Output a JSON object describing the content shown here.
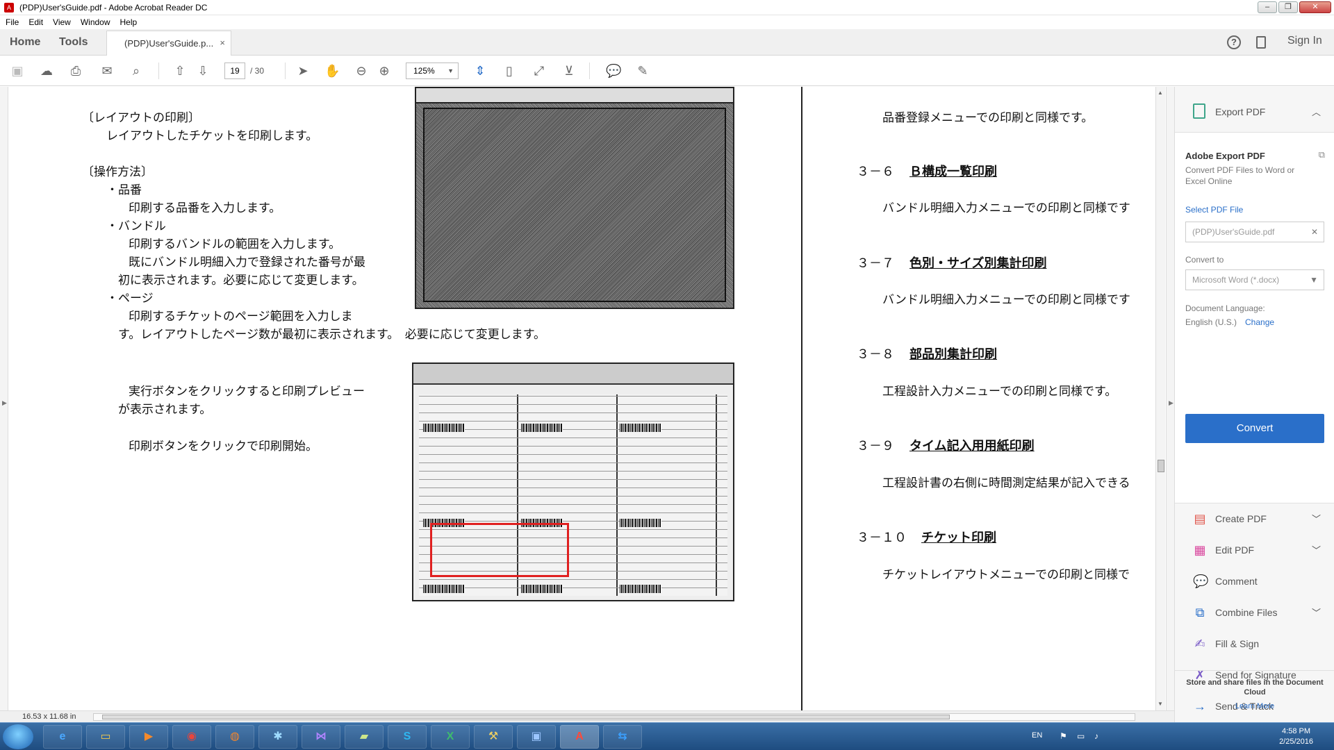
{
  "window": {
    "title": "(PDP)User'sGuide.pdf - Adobe Acrobat Reader DC",
    "controls": [
      "–",
      "❐",
      "✕"
    ]
  },
  "menu": [
    "File",
    "Edit",
    "View",
    "Window",
    "Help"
  ],
  "tabs": {
    "home": "Home",
    "tools": "Tools",
    "doc_tab": "(PDP)User'sGuide.p...",
    "close": "×",
    "help_icon": "?",
    "sign_in": "Sign In"
  },
  "toolbar": {
    "page_current": "19",
    "page_total": "/ 30",
    "zoom": "125%"
  },
  "document": {
    "left": {
      "layout_heading": "〔レイアウトの印刷〕",
      "layout_desc": "レイアウトしたチケットを印刷します。",
      "method_heading": "〔操作方法〕",
      "item1_title": "・品番",
      "item1_desc": "印刷する品番を入力します。",
      "item2_title": "・バンドル",
      "item2_desc1": "印刷するバンドルの範囲を入力します。",
      "item2_desc2": "既にバンドル明細入力で登録された番号が最",
      "item2_desc3": "初に表示されます。必要に応じて変更します。",
      "item3_title": "・ページ",
      "item3_desc1": "印刷するチケットのページ範囲を入力しま",
      "item3_desc2": "す。レイアウトしたページ数が最初に表示されます。　必要に応じて変更します。",
      "exec_desc1": "実行ボタンをクリックすると印刷プレビュー",
      "exec_desc2": "が表示されます。",
      "print_desc": "印刷ボタンをクリックで印刷開始。"
    },
    "right": {
      "s35_desc": "品番登録メニューでの印刷と同様です。",
      "s36_num": "３－６",
      "s36_title": "Ｂ構成一覧印刷",
      "s36_desc": "バンドル明細入力メニューでの印刷と同様です",
      "s37_num": "３－７",
      "s37_title": "色別・サイズ別集計印刷",
      "s37_desc": "バンドル明細入力メニューでの印刷と同様です",
      "s38_num": "３－８",
      "s38_title": "部品別集計印刷",
      "s38_desc": "工程設計入力メニューでの印刷と同様です。",
      "s39_num": "３－９",
      "s39_title": "タイム記入用用紙印刷",
      "s39_desc": "工程設計書の右側に時間測定結果が記入できる",
      "s310_num": "３－１０",
      "s310_title": "チケット印刷",
      "s310_desc": "チケットレイアウトメニューでの印刷と同様で"
    }
  },
  "status": {
    "dimensions": "16.53 x 11.68 in"
  },
  "right_pane": {
    "export_label": "Export PDF",
    "panel_title": "Adobe Export PDF",
    "panel_desc": "Convert PDF Files to Word or Excel Online",
    "select_file": "Select PDF File",
    "file_name": "(PDP)User'sGuide.pdf",
    "convert_to_label": "Convert to",
    "convert_to_value": "Microsoft Word (*.docx)",
    "doc_lang_label": "Document Language:",
    "doc_lang_value": "English (U.S.)",
    "change_link": "Change",
    "convert_button": "Convert",
    "tools": [
      {
        "label": "Create PDF",
        "color": "#e0544a",
        "has_chevron": true
      },
      {
        "label": "Edit PDF",
        "color": "#d9479e",
        "has_chevron": true
      },
      {
        "label": "Comment",
        "color": "#f2b200",
        "has_chevron": false
      },
      {
        "label": "Combine Files",
        "color": "#2a6fc9",
        "has_chevron": true
      },
      {
        "label": "Fill & Sign",
        "color": "#7a5bc7",
        "has_chevron": false
      },
      {
        "label": "Send for Signature",
        "color": "#7a5bc7",
        "has_chevron": false
      },
      {
        "label": "Send & Track",
        "color": "#2a6fc9",
        "has_chevron": false
      }
    ],
    "cloud_text": "Store and share files in the Document Cloud",
    "learn_more": "Learn More"
  },
  "taskbar": {
    "language": "EN",
    "time": "4:58 PM",
    "date": "2/25/2016"
  }
}
